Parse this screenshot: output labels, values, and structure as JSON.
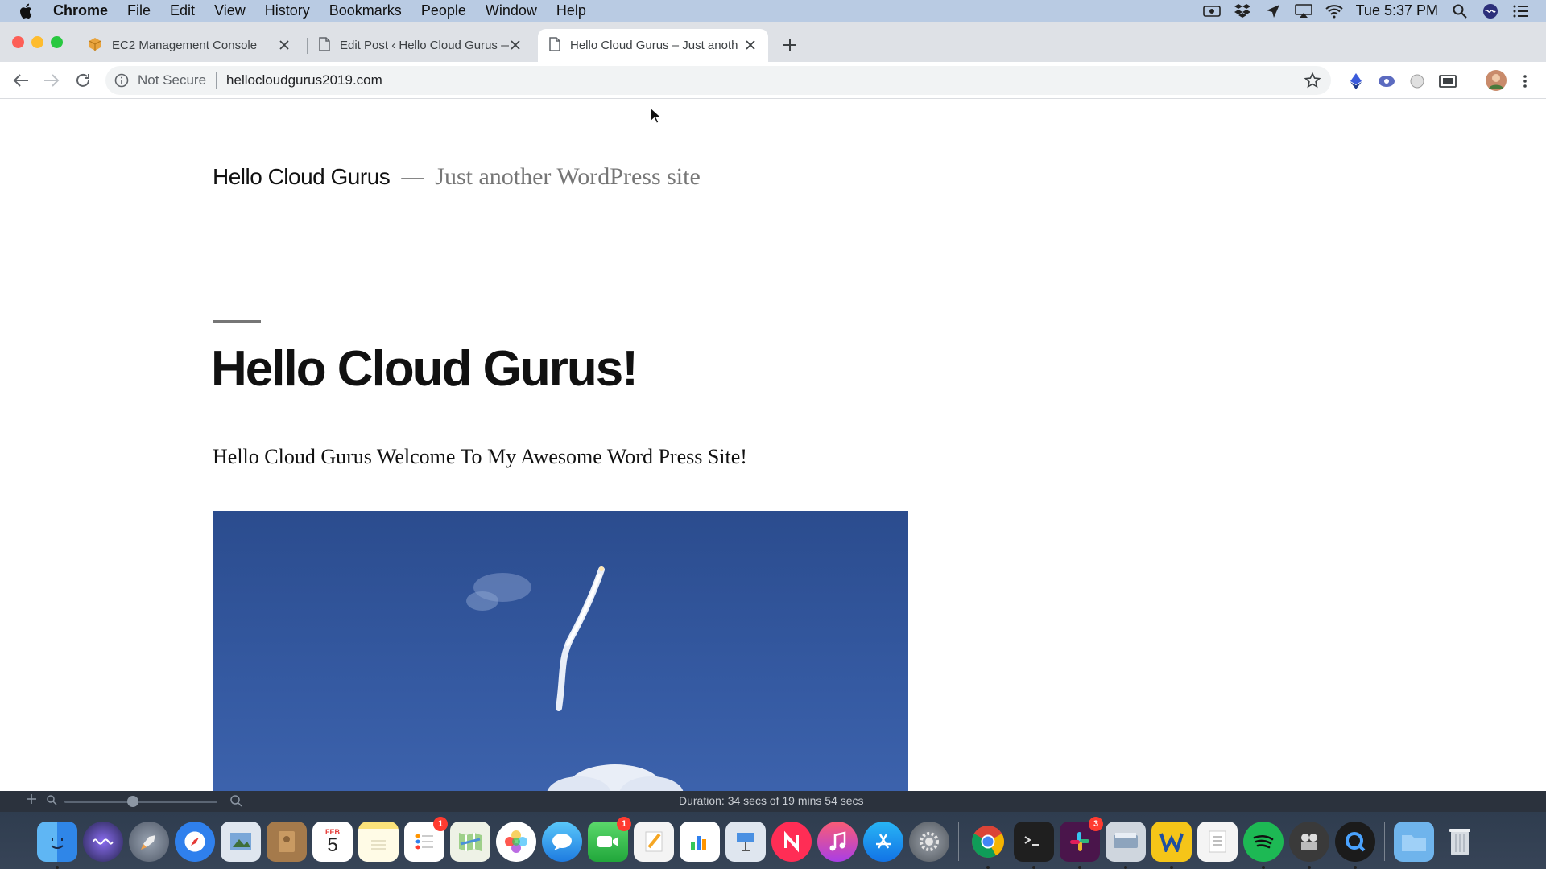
{
  "menubar": {
    "app_name": "Chrome",
    "items": [
      "File",
      "Edit",
      "View",
      "History",
      "Bookmarks",
      "People",
      "Window",
      "Help"
    ],
    "clock": "Tue 5:37 PM"
  },
  "tabs": [
    {
      "title": "EC2 Management Console",
      "icon": "aws-cube-icon"
    },
    {
      "title": "Edit Post ‹ Hello Cloud Gurus —",
      "icon": "page-icon"
    },
    {
      "title": "Hello Cloud Gurus – Just anoth",
      "icon": "page-icon",
      "active": true
    }
  ],
  "omnibox": {
    "security": "Not Secure",
    "url": "hellocloudgurus2019.com"
  },
  "page": {
    "site_title": "Hello Cloud Gurus",
    "site_dash": "—",
    "site_description": "Just another WordPress site",
    "post_title": "Hello Cloud Gurus!",
    "post_body": "Hello Cloud Gurus Welcome To My Awesome Word Press Site!"
  },
  "player": {
    "duration": "Duration: 34 secs of 19 mins 54 secs"
  },
  "dock": {
    "calendar_month": "FEB",
    "calendar_day": "5",
    "reminders_badge": "1",
    "facetime_badge": "1",
    "slack_badge": "3"
  },
  "colors": {
    "menubar": "#b9cbe3",
    "tabstrip": "#dee1e6",
    "image_sky": "#2f53a0"
  }
}
